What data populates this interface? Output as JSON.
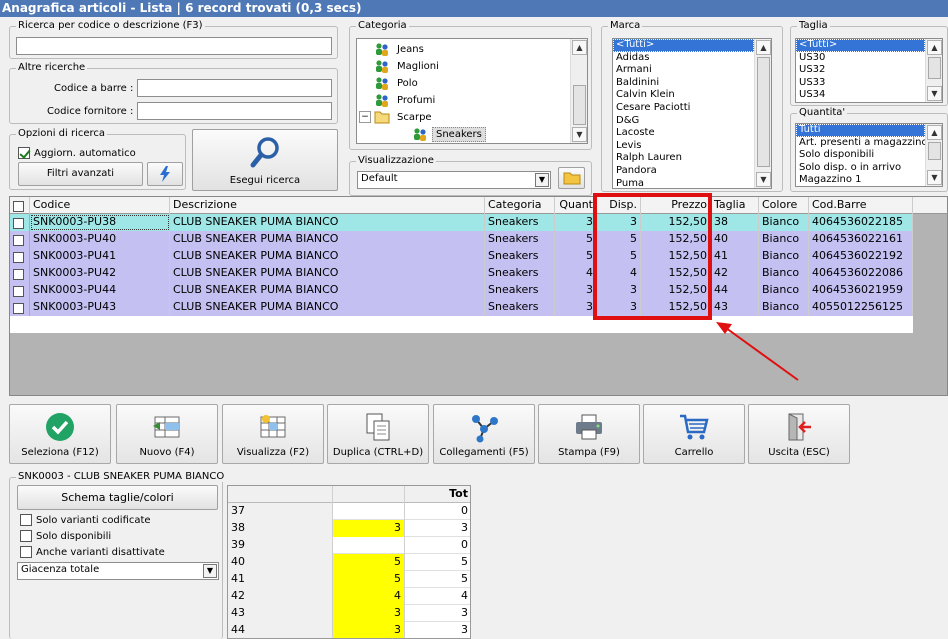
{
  "window": {
    "title": "Anagrafica articoli  - Lista | 6 record trovati (0,3 secs)"
  },
  "search": {
    "group_label": "Ricerca per codice o descrizione (F3)",
    "value": "",
    "altre_label": "Altre ricerche",
    "barcode_label": "Codice a barre :",
    "barcode_value": "",
    "supplier_label": "Codice fornitore :",
    "supplier_value": "",
    "options_label": "Opzioni di ricerca",
    "auto_update_label": "Aggiorn. automatico",
    "auto_update_checked": true,
    "advanced_filters_label": "Filtri avanzati",
    "execute_label": "Esegui ricerca"
  },
  "categoria": {
    "label": "Categoria",
    "items": [
      {
        "label": "Jeans",
        "indent": 1,
        "icon": "people-icon"
      },
      {
        "label": "Maglioni",
        "indent": 1,
        "icon": "people-icon"
      },
      {
        "label": "Polo",
        "indent": 1,
        "icon": "people-icon"
      },
      {
        "label": "Profumi",
        "indent": 1,
        "icon": "people-icon"
      },
      {
        "label": "Scarpe",
        "indent": 1,
        "icon": "folder-icon",
        "expander": "−"
      },
      {
        "label": "Sneakers",
        "indent": 2,
        "icon": "people-icon",
        "selected": true
      }
    ]
  },
  "visualizzazione": {
    "label": "Visualizzazione",
    "value": "Default"
  },
  "marca": {
    "label": "Marca",
    "items": [
      "<Tutti>",
      "Adidas",
      "Armani",
      "Baldinini",
      "Calvin Klein",
      "Cesare Paciotti",
      "D&G",
      "Lacoste",
      "Levis",
      "Ralph Lauren",
      "Pandora",
      "Puma"
    ]
  },
  "taglia": {
    "label": "Taglia",
    "items": [
      "<Tutti>",
      "US30",
      "US32",
      "US33",
      "US34"
    ]
  },
  "quantita": {
    "label": "Quantita'",
    "items": [
      "Tutti",
      "Art. presenti a magazzino",
      "Solo disponibili",
      "Solo disp. o in arrivo",
      "Magazzino 1"
    ]
  },
  "table": {
    "columns": [
      "Codice",
      "Descrizione",
      "Categoria",
      "Quant",
      "Disp.",
      "Prezzo",
      "Taglia",
      "Colore",
      "Cod.Barre"
    ],
    "rows": [
      [
        "SNK0003-PU38",
        "CLUB SNEAKER PUMA BIANCO",
        "Sneakers",
        "3",
        "3",
        "152,50",
        "38",
        "Bianco",
        "4064536022185"
      ],
      [
        "SNK0003-PU40",
        "CLUB SNEAKER PUMA BIANCO",
        "Sneakers",
        "5",
        "5",
        "152,50",
        "40",
        "Bianco",
        "4064536022161"
      ],
      [
        "SNK0003-PU41",
        "CLUB SNEAKER PUMA BIANCO",
        "Sneakers",
        "5",
        "5",
        "152,50",
        "41",
        "Bianco",
        "4064536022192"
      ],
      [
        "SNK0003-PU42",
        "CLUB SNEAKER PUMA BIANCO",
        "Sneakers",
        "4",
        "4",
        "152,50",
        "42",
        "Bianco",
        "4064536022086"
      ],
      [
        "SNK0003-PU44",
        "CLUB SNEAKER PUMA BIANCO",
        "Sneakers",
        "3",
        "3",
        "152,50",
        "44",
        "Bianco",
        "4064536021959"
      ],
      [
        "SNK0003-PU43",
        "CLUB SNEAKER PUMA BIANCO",
        "Sneakers",
        "3",
        "3",
        "152,50",
        "43",
        "Bianco",
        "4055012256125"
      ]
    ]
  },
  "toolbar": {
    "buttons": [
      {
        "label": "Seleziona (F12)",
        "icon": "check-circle-icon"
      },
      {
        "label": "Nuovo (F4)",
        "icon": "new-record-icon"
      },
      {
        "label": "Visualizza (F2)",
        "icon": "view-grid-icon"
      },
      {
        "label": "Duplica (CTRL+D)",
        "icon": "duplicate-icon"
      },
      {
        "label": "Collegamenti (F5)",
        "icon": "links-icon"
      },
      {
        "label": "Stampa (F9)",
        "icon": "printer-icon"
      },
      {
        "label": "Carrello",
        "icon": "cart-icon"
      },
      {
        "label": "Uscita (ESC)",
        "icon": "exit-door-icon"
      }
    ]
  },
  "detail": {
    "group_label": "SNK0003 - CLUB SNEAKER PUMA BIANCO",
    "schema_button": "Schema taglie/colori",
    "only_coded_label": "Solo varianti codificate",
    "only_available_label": "Solo disponibili",
    "disabled_variants_label": "Anche varianti disattivate",
    "stock_select_value": "Giacenza totale",
    "size_table": {
      "header_tot": "Tot",
      "rows": [
        {
          "size": "37",
          "qty": "",
          "tot": "0"
        },
        {
          "size": "38",
          "qty": "3",
          "tot": "3"
        },
        {
          "size": "39",
          "qty": "",
          "tot": "0"
        },
        {
          "size": "40",
          "qty": "5",
          "tot": "5"
        },
        {
          "size": "41",
          "qty": "5",
          "tot": "5"
        },
        {
          "size": "42",
          "qty": "4",
          "tot": "4"
        },
        {
          "size": "43",
          "qty": "3",
          "tot": "3"
        },
        {
          "size": "44",
          "qty": "3",
          "tot": "3"
        }
      ]
    }
  },
  "colors": {
    "title_bar": "#4f78b6",
    "row_selected": "#9fe6e6",
    "row_highlight": "#c4c0f2",
    "qty_yellow": "#ffff00",
    "annotation_red": "#e01010",
    "list_selected": "#3374d6"
  }
}
